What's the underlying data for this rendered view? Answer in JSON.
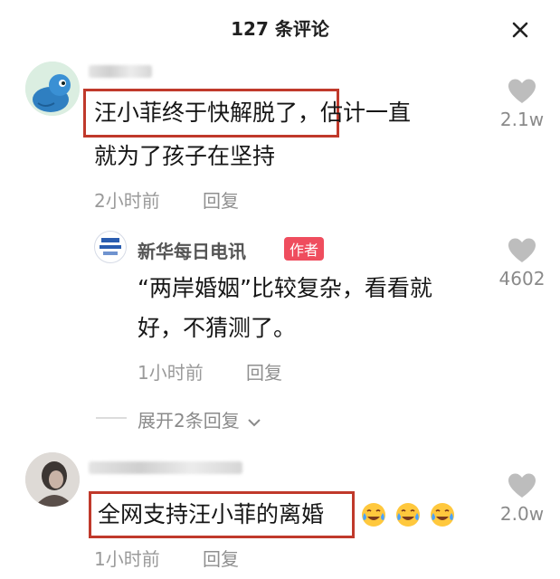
{
  "header": {
    "title": "127 条评论",
    "close_icon": "close-icon"
  },
  "comments": [
    {
      "line1": "汪小菲终于快解脱了",
      "line1_rest": "，估计一直",
      "line2": "就为了孩子在坚持",
      "time": "2小时前",
      "reply_label": "回复",
      "likes": "2.1w"
    },
    {
      "author": "新华每日电讯",
      "badge": "作者",
      "line1": "“两岸婚姻”比较复杂，看看就",
      "line2": "好，不猜测了。",
      "time": "1小时前",
      "reply_label": "回复",
      "likes": "4602"
    },
    {
      "line1": "全网支持汪小菲的离婚",
      "time": "1小时前",
      "reply_label": "回复",
      "likes": "2.0w"
    }
  ],
  "expand": {
    "label": "展开2条回复"
  },
  "colors": {
    "highlight": "#c0392b",
    "badge": "#ef4d5e",
    "muted": "#9a9a9a"
  },
  "icons": [
    "heart-icon",
    "chevron-down-icon",
    "laughing-tears-emoji"
  ]
}
